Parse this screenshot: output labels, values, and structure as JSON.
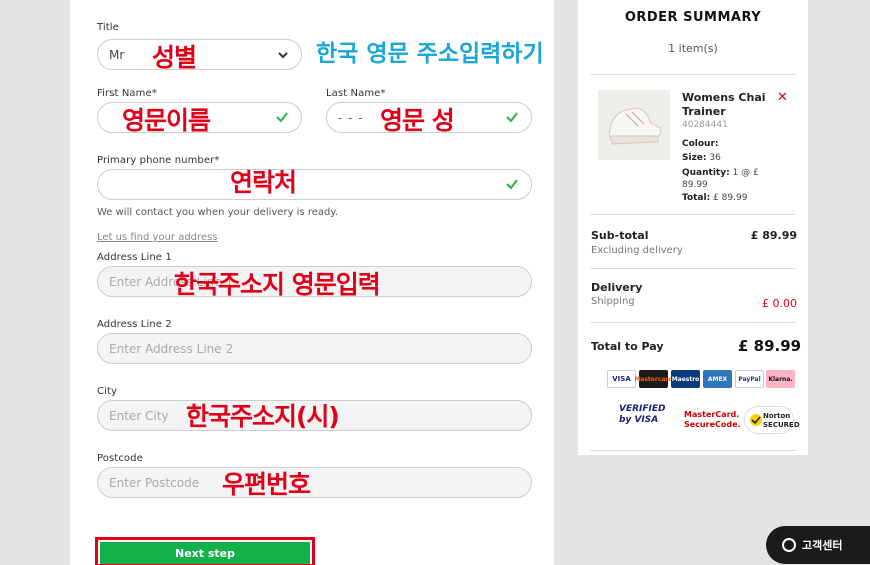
{
  "form": {
    "title_label": "Title",
    "title_value": "Mr",
    "first_name_label": "First Name*",
    "last_name_label": "Last Name*",
    "last_name_value": "- - -",
    "phone_label": "Primary phone number*",
    "phone_note": "We will contact you when your delivery is ready.",
    "find_address_link": "Let us find your address",
    "address1_label": "Address Line 1",
    "address1_placeholder": "Enter Address Line 1",
    "address2_label": "Address Line 2",
    "address2_placeholder": "Enter Address Line 2",
    "city_label": "City",
    "city_placeholder": "Enter City",
    "postcode_label": "Postcode",
    "postcode_placeholder": "Enter Postcode",
    "next_button": "Next step"
  },
  "annotations": {
    "gender": "성별",
    "header": "한국 영문 주소입력하기",
    "first_name": "영문이름",
    "last_name": "영문 성",
    "phone": "연락처",
    "address1": "한국주소지 영문입력",
    "city": "한국주소지(시)",
    "postcode": "우편번호"
  },
  "summary": {
    "title": "ORDER SUMMARY",
    "count": "1 item(s)",
    "product_name": "Womens Chai Trainer",
    "product_code": "40284441",
    "colour_label": "Colour:",
    "size_label": "Size:",
    "size_value": "36",
    "quantity_label": "Quantity:",
    "quantity_value": "1 @ £ 89.99",
    "total_label": "Total:",
    "total_value": "£ 89.99",
    "subtotal_label": "Sub-total",
    "subtotal_value": "£ 89.99",
    "subtotal_note": "Excluding delivery",
    "delivery_label": "Delivery",
    "shipping_label": "Shipping",
    "shipping_value": "£ 0.00",
    "total_to_pay_label": "Total to Pay",
    "total_to_pay_value": "£ 89.99",
    "payments": [
      "VISA",
      "Mastercard",
      "Maestro",
      "AMEX",
      "PayPal",
      "Klarna."
    ],
    "verified_visa": "VERIFIED by VISA",
    "mastercard_secure": "MasterCard. SecureCode.",
    "norton": "Norton SECURED"
  },
  "chat": {
    "label": "고객센터"
  },
  "colors": {
    "accent_green": "#14b04a",
    "annotation_red": "#e0001a",
    "annotation_blue": "#1aa6d6"
  }
}
